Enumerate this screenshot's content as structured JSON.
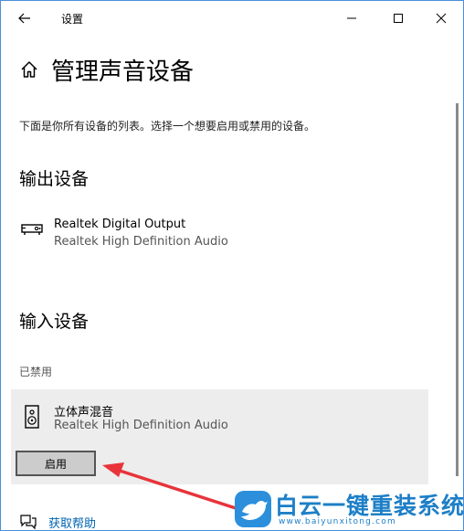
{
  "titlebar": {
    "app_title": "设置",
    "icons": {
      "back": "back-arrow-icon",
      "minimize": "minimize-icon",
      "maximize": "maximize-icon",
      "close": "close-icon"
    }
  },
  "header": {
    "page_title": "管理声音设备",
    "home_icon": "home-icon"
  },
  "description": "下面是你所有设备的列表。选择一个想要启用或禁用的设备。",
  "output_section": {
    "title": "输出设备",
    "devices": [
      {
        "name": "Realtek Digital Output",
        "subtitle": "Realtek High Definition Audio",
        "icon": "digital-output-icon"
      }
    ]
  },
  "input_section": {
    "title": "输入设备",
    "disabled_label": "已禁用",
    "devices": [
      {
        "name": "立体声混音",
        "subtitle": "Realtek High Definition Audio",
        "icon": "speaker-icon",
        "action_label": "启用"
      }
    ]
  },
  "help": {
    "label": "获取帮助",
    "icon": "help-chat-icon"
  },
  "watermark": {
    "title": "白云一键重装系统",
    "url": "www.baiyunxitong.com",
    "logo": "bird-logo-icon"
  },
  "colors": {
    "window_border": "#4a8fd8",
    "link": "#0063b1",
    "arrow": "#e8333a",
    "watermark": "#1d7fc7",
    "card_bg": "#ededed",
    "button_bg": "#cccccc"
  }
}
